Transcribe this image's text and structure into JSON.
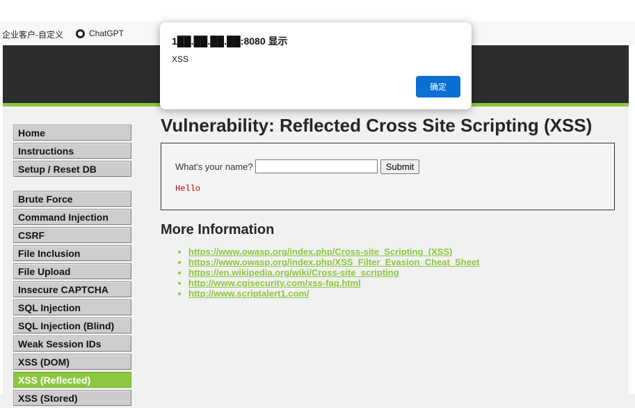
{
  "bookmarks": [
    {
      "label": "企业客户-自定义"
    },
    {
      "label": "ChatGPT",
      "icon": "chatgpt-icon"
    }
  ],
  "menu": {
    "group1": [
      "Home",
      "Instructions",
      "Setup / Reset DB"
    ],
    "group2": [
      "Brute Force",
      "Command Injection",
      "CSRF",
      "File Inclusion",
      "File Upload",
      "Insecure CAPTCHA",
      "SQL Injection",
      "SQL Injection (Blind)",
      "Weak Session IDs",
      "XSS (DOM)",
      "XSS (Reflected)",
      "XSS (Stored)"
    ],
    "active": "XSS (Reflected)"
  },
  "main": {
    "title": "Vulnerability: Reflected Cross Site Scripting (XSS)",
    "form": {
      "question": "What's your name?",
      "input_value": "",
      "submit_label": "Submit",
      "output": "Hello"
    },
    "more_info_heading": "More Information",
    "links": [
      "https://www.owasp.org/index.php/Cross-site_Scripting_(XSS)",
      "https://www.owasp.org/index.php/XSS_Filter_Evasion_Cheat_Sheet",
      "https://en.wikipedia.org/wiki/Cross-site_scripting",
      "http://www.cgisecurity.com/xss-faq.html",
      "http://www.scriptalert1.com/"
    ]
  },
  "dialog": {
    "title": "1██.██.██.██:8080 显示",
    "message": "XSS",
    "ok_label": "确定"
  },
  "colors": {
    "accent": "#8cc63f",
    "header": "#2d2d2d",
    "dialog_button": "#0b6fd3",
    "output_text": "#c00000"
  }
}
